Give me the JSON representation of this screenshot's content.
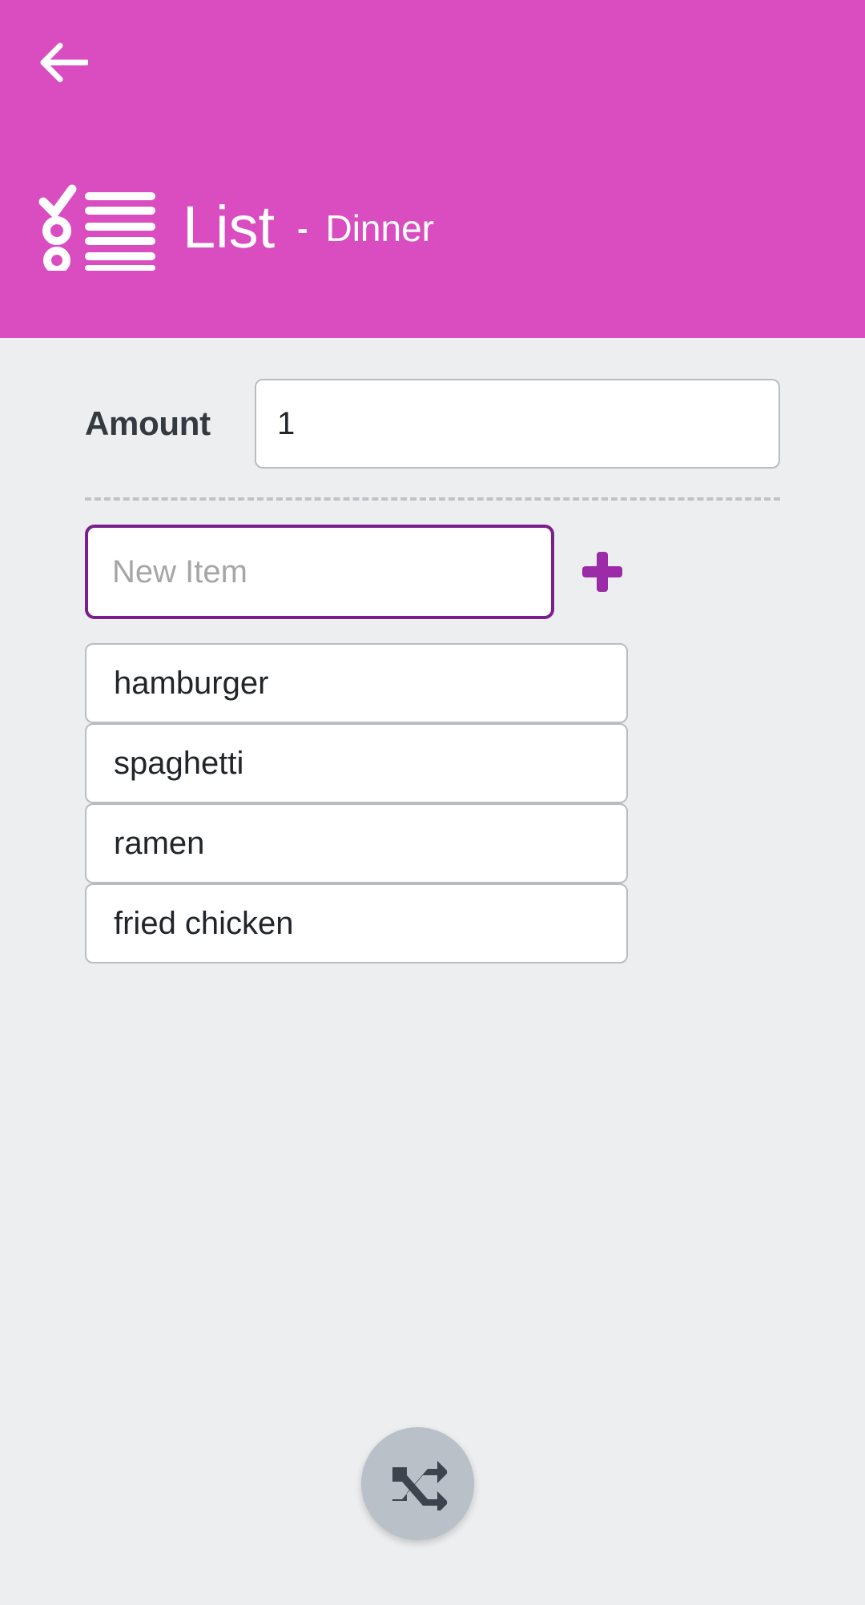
{
  "app": {
    "title": "List",
    "separator": "-",
    "list_name": "Dinner",
    "header_color": "#d94dc0",
    "accent_color": "#7b1f8e",
    "background_color": "#eceef0"
  },
  "header": {
    "back_icon": "arrow-left-icon",
    "brand_icon": "checklist-icon"
  },
  "form": {
    "amount_label": "Amount",
    "amount_value": "1",
    "new_item_placeholder": "New Item",
    "new_item_value": "",
    "add_icon": "plus-icon"
  },
  "items": [
    {
      "label": "hamburger"
    },
    {
      "label": "spaghetti"
    },
    {
      "label": "ramen"
    },
    {
      "label": "fried chicken"
    }
  ],
  "fab": {
    "icon": "shuffle-icon",
    "color": "#b9c0c8",
    "icon_color": "#3c444e"
  }
}
